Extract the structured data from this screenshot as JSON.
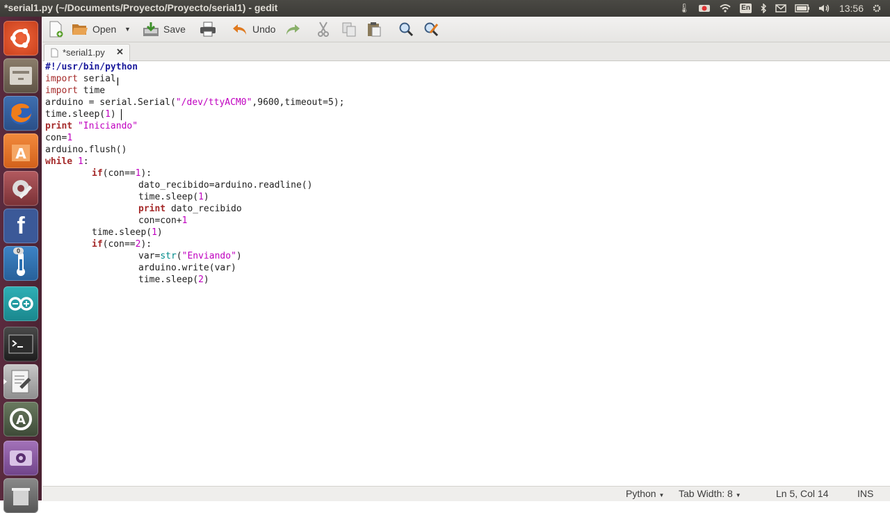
{
  "window": {
    "title": "*serial1.py (~/Documents/Proyecto/Proyecto/serial1) - gedit"
  },
  "topbar": {
    "clock": "13:56",
    "keyboard": "En"
  },
  "launcher": {
    "items": [
      {
        "name": "dash-home",
        "color": "#e1502b"
      },
      {
        "name": "files",
        "color": "#7d6f5f"
      },
      {
        "name": "firefox",
        "color": "#e66b1c"
      },
      {
        "name": "software-center",
        "color": "#e9782c"
      },
      {
        "name": "system-settings",
        "color": "#9b4a4f"
      },
      {
        "name": "facebook",
        "color": "#3b5998"
      },
      {
        "name": "thermometer",
        "color": "#3878b5"
      },
      {
        "name": "arduino",
        "color": "#2a9aa0"
      },
      {
        "name": "terminal",
        "color": "#2c2c2c"
      },
      {
        "name": "text-editor",
        "color": "#9a9a9a"
      },
      {
        "name": "software-updater",
        "color": "#4a5a45"
      },
      {
        "name": "webcam",
        "color": "#8a5aa0"
      },
      {
        "name": "trash",
        "color": "#6a6a6a"
      }
    ],
    "counter_badge": "0"
  },
  "toolbar": {
    "open_label": "Open",
    "save_label": "Save",
    "undo_label": "Undo"
  },
  "tab": {
    "label": "*serial1.py",
    "close": "✕"
  },
  "statusbar": {
    "language": "Python",
    "tab_width": "Tab Width: 8",
    "position": "Ln 5, Col 14",
    "mode": "INS"
  },
  "code": {
    "l1": "#!/usr/bin/python",
    "l2_kw": "import",
    "l2_rest": " serial",
    "l3_kw": "import",
    "l3_rest": " time",
    "l4_a": "arduino = serial.Serial(",
    "l4_s": "\"/dev/ttyACM0\"",
    "l4_b": ",9600,timeout=5);",
    "l5_a": "time.sleep(",
    "l5_n": "1",
    "l5_b": ")",
    "l6_kw": "print",
    "l6_s": " \"Iniciando\"",
    "l7_a": "con=",
    "l7_n": "1",
    "l8": "arduino.flush()",
    "l9_kw": "while",
    "l9_n": " 1",
    "l9_b": ":",
    "l10_kw": "if",
    "l10_a": "(con==",
    "l10_n": "1",
    "l10_b": "):",
    "l11": "dato_recibido=arduino.readline()",
    "l12_a": "time.sleep(",
    "l12_n": "1",
    "l12_b": ")",
    "l13_kw": "print",
    "l13_rest": " dato_recibido",
    "l14_a": "con=con+",
    "l14_n": "1",
    "l15_a": "time.sleep(",
    "l15_n": "1",
    "l15_b": ")",
    "l16_kw": "if",
    "l16_a": "(con==",
    "l16_n": "2",
    "l16_b": "):",
    "l17_a": "var=",
    "l17_bi": "str",
    "l17_b": "(",
    "l17_s": "\"Enviando\"",
    "l17_c": ")",
    "l18": "arduino.write(var)",
    "l19_a": "time.sleep(",
    "l19_n": "2",
    "l19_b": ")"
  }
}
